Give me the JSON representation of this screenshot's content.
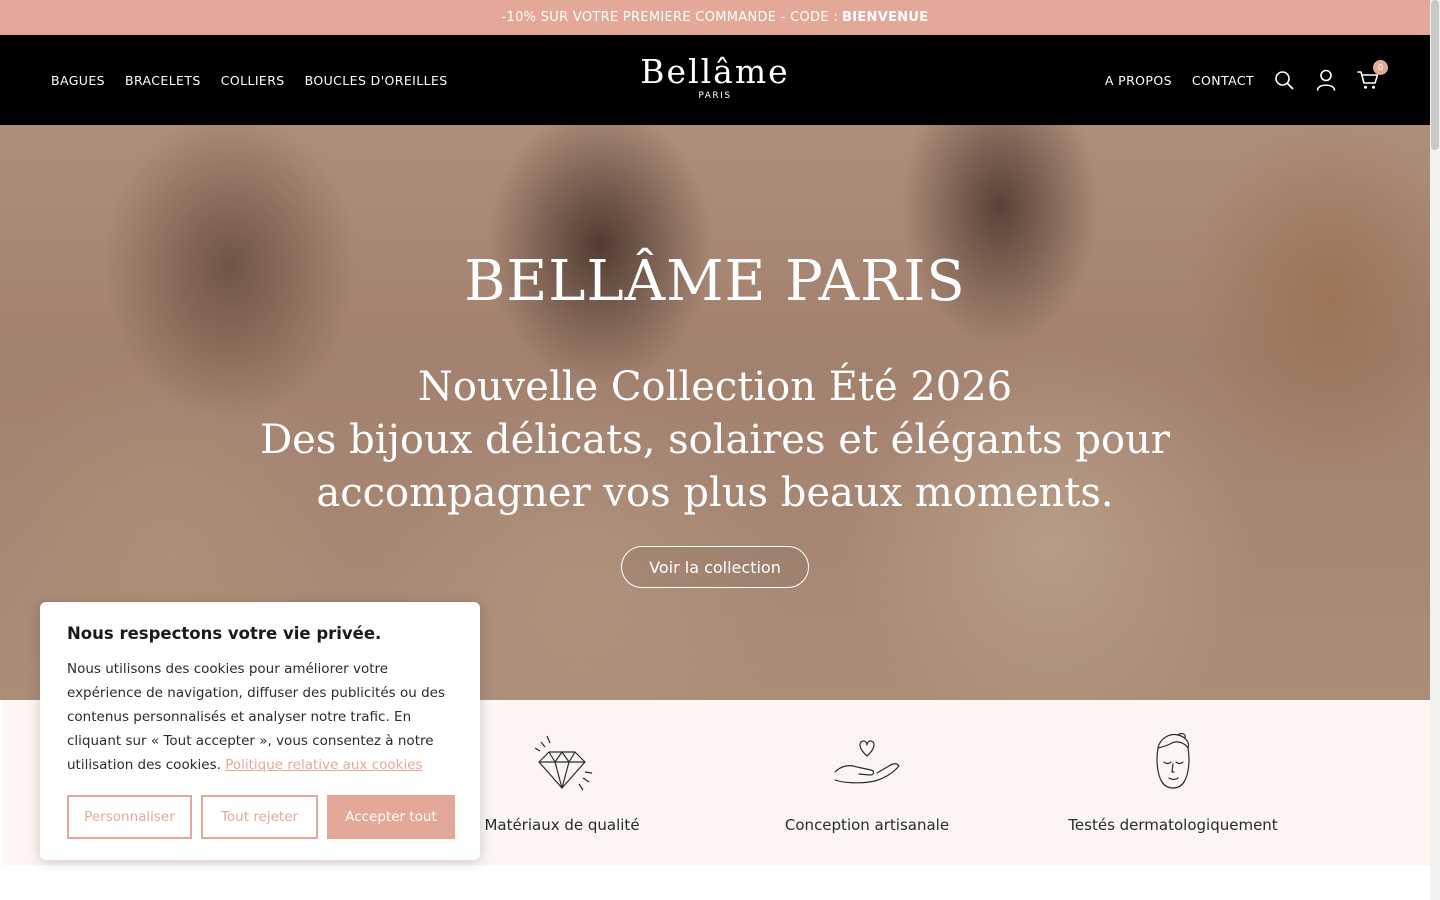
{
  "announcement": {
    "text": "-10% SUR VOTRE PREMIERE COMMANDE - CODE :",
    "code": "BIENVENUE"
  },
  "header": {
    "nav_left": [
      "BAGUES",
      "BRACELETS",
      "COLLIERS",
      "BOUCLES D'OREILLES"
    ],
    "logo": {
      "main": "Bellâme",
      "sub": "PARIS"
    },
    "nav_right": [
      "A PROPOS",
      "CONTACT"
    ],
    "icons": [
      "search-icon",
      "account-icon",
      "cart-icon"
    ],
    "cart_count": "0"
  },
  "hero": {
    "title": "BELLÂME PARIS",
    "subtitle_line1": "Nouvelle Collection Été 2026",
    "subtitle_line2": "Des bijoux délicats, solaires et élégants pour accompagner vos plus beaux moments.",
    "cta": "Voir la collection"
  },
  "features": [
    {
      "icon": "diamond-icon",
      "label": "Matériaux de qualité"
    },
    {
      "icon": "hand-heart-icon",
      "label": "Conception artisanale"
    },
    {
      "icon": "face-icon",
      "label": "Testés dermatologiquement"
    }
  ],
  "cookie_banner": {
    "title": "Nous respectons votre vie privée.",
    "text": "Nous utilisons des cookies pour améliorer votre expérience de navigation, diffuser des publicités ou des contenus personnalisés et analyser notre trafic. En cliquant sur « Tout accepter », vous consentez à notre utilisation des cookies.",
    "link": "Politique relative aux cookies",
    "buttons": {
      "customize": "Personnaliser",
      "reject": "Tout rejeter",
      "accept": "Accepter tout"
    }
  },
  "colors": {
    "accent": "#e4a898",
    "header_bg": "#000000",
    "features_bg": "#fcf5f2"
  }
}
